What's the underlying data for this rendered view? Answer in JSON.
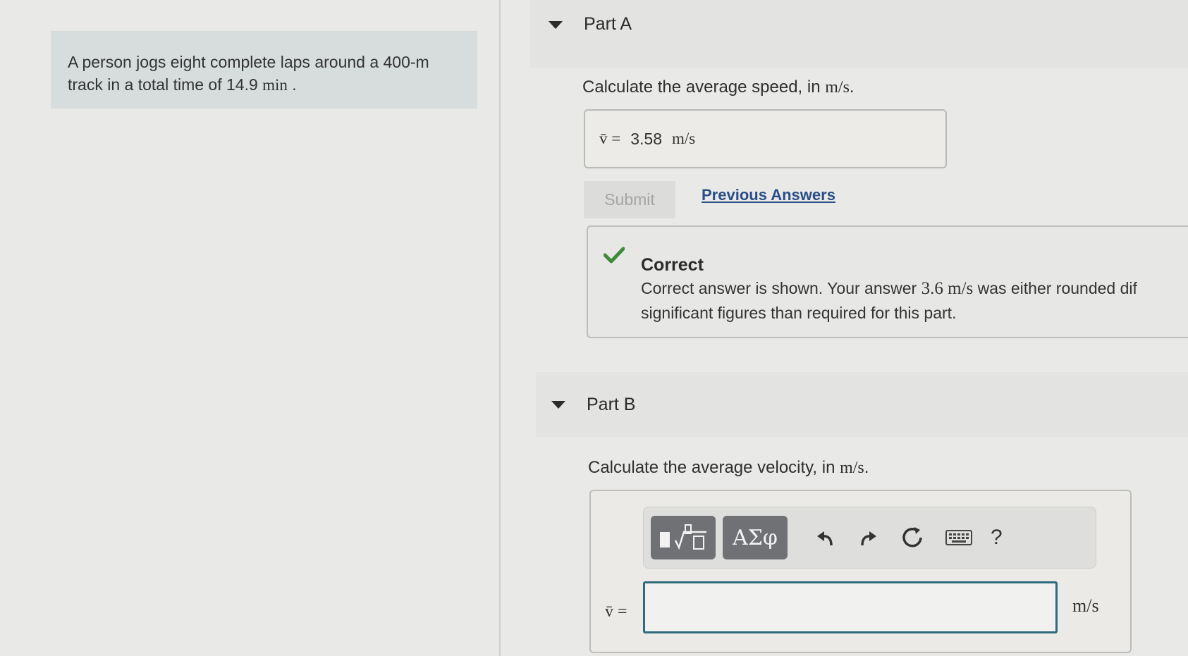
{
  "problem": {
    "text_line1": "A person jogs eight complete laps around a 400-m",
    "text_line2_prefix": "track in a total time of 14.9 ",
    "text_line2_unit": "min",
    "text_line2_suffix": " ."
  },
  "part_a": {
    "title": "Part A",
    "prompt_prefix": "Calculate the average speed, in ",
    "prompt_unit": "m/s",
    "prompt_suffix": ".",
    "answer_label": "v̄ =",
    "answer_value": "3.58",
    "answer_unit": "m/s",
    "submit_label": "Submit",
    "previous_answers_label": "Previous Answers",
    "feedback": {
      "status": "Correct",
      "message_prefix": "Correct answer is shown. Your answer ",
      "message_value": "3.6 m/s",
      "message_suffix": " was either rounded dif",
      "message_line2": "significant figures than required for this part."
    }
  },
  "part_b": {
    "title": "Part B",
    "prompt_prefix": "Calculate the average velocity, in ",
    "prompt_unit": "m/s",
    "prompt_suffix": ".",
    "toolbar": {
      "templates_icon": "templates-icon",
      "symbols_label": "ΑΣφ",
      "undo_icon": "undo-icon",
      "redo_icon": "redo-icon",
      "reset_icon": "reset-icon",
      "keyboard_icon": "keyboard-icon",
      "help_label": "?"
    },
    "input_label": "v̄ =",
    "input_value": "",
    "unit_label": "m/s"
  },
  "colors": {
    "link": "#2a4f86",
    "check": "#3d8a3a",
    "toolbar_button": "#6f7175",
    "input_border": "#2e6b7c"
  }
}
